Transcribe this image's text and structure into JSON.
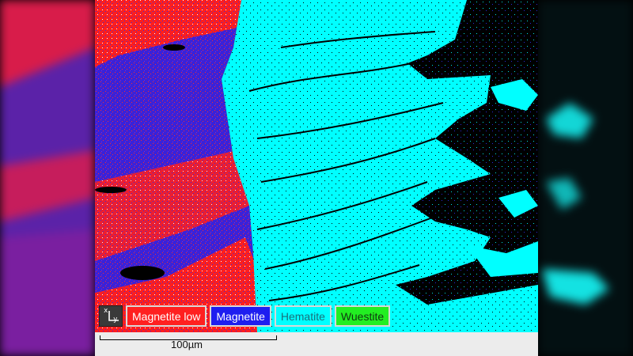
{
  "legend": {
    "axes_icon": "xy-axes-icon",
    "axis_labels": {
      "x": "x",
      "y": "y"
    },
    "phases": [
      {
        "label": "Magnetite low",
        "color": "#ff2020",
        "text_color": "#ffffff"
      },
      {
        "label": "Magnetite",
        "color": "#1e1ef0",
        "text_color": "#ffffff"
      },
      {
        "label": "Hematite",
        "color": "#00ffff",
        "text_color": "#1a6f7a"
      },
      {
        "label": "Wuestite",
        "color": "#22ee22",
        "text_color": "#103810"
      }
    ]
  },
  "scale_bar": {
    "label": "100µm"
  }
}
